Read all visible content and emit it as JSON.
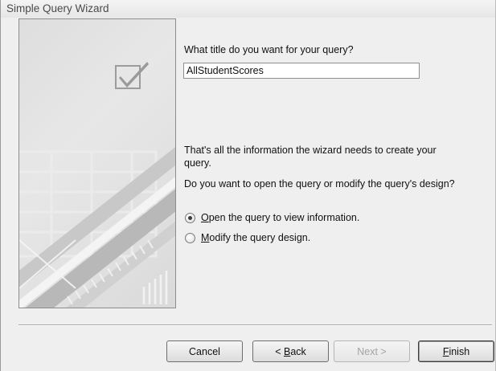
{
  "window": {
    "title": "Simple Query Wizard"
  },
  "form": {
    "title_prompt": "What title do you want for your query?",
    "title_value": "AllStudentScores",
    "info_line1": "That's all the information the wizard needs to create your",
    "info_line2": "query.",
    "question": "Do you want to open the query or modify the query's design?",
    "options": [
      {
        "accel": "O",
        "rest": "pen the query to view information.",
        "selected": true
      },
      {
        "accel": "M",
        "rest": "odify the query design.",
        "selected": false
      }
    ]
  },
  "buttons": {
    "cancel": "Cancel",
    "back_prefix": "< ",
    "back_accel": "B",
    "back_rest": "ack",
    "next": "Next >",
    "finish_accel": "F",
    "finish_rest": "inish"
  },
  "icons": {
    "side_panel": "checkmark-icon",
    "radio": "radio-button-icon"
  },
  "colors": {
    "background": "#efefef",
    "panel": "#dedede",
    "disabled_text": "#a3a3a3"
  }
}
